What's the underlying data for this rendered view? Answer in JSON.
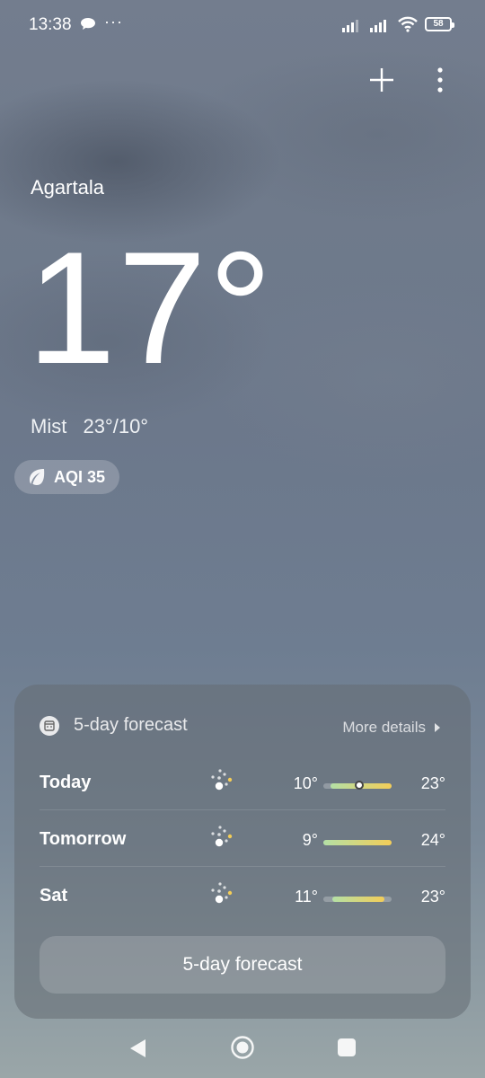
{
  "status_bar": {
    "time": "13:38",
    "more": "···",
    "battery": "58"
  },
  "header": {
    "add_icon": "plus-icon",
    "menu_icon": "kebab-menu-icon"
  },
  "weather": {
    "city": "Agartala",
    "temperature": "17°",
    "condition": "Mist",
    "high_low": "23°/10°",
    "aqi_label": "AQI 35",
    "aqi_icon": "leaf-icon"
  },
  "forecast": {
    "title": "5-day forecast",
    "more_details": "More details",
    "days": [
      {
        "day": "Today",
        "low": "10°",
        "high": "23°",
        "icon": "mist-icon",
        "bar_start": 0.1,
        "bar_end": 1.0,
        "current": 0.53
      },
      {
        "day": "Tomorrow",
        "low": "9°",
        "high": "24°",
        "icon": "mist-icon",
        "bar_start": 0.0,
        "bar_end": 1.0
      },
      {
        "day": "Sat",
        "low": "11°",
        "high": "23°",
        "icon": "mist-icon",
        "bar_start": 0.13,
        "bar_end": 0.9
      }
    ],
    "button_label": "5-day forecast"
  },
  "colors": {
    "bar_cool": "#b4e0a6",
    "bar_warm": "#f3cd58",
    "icon_sun": "#f3cd58"
  }
}
